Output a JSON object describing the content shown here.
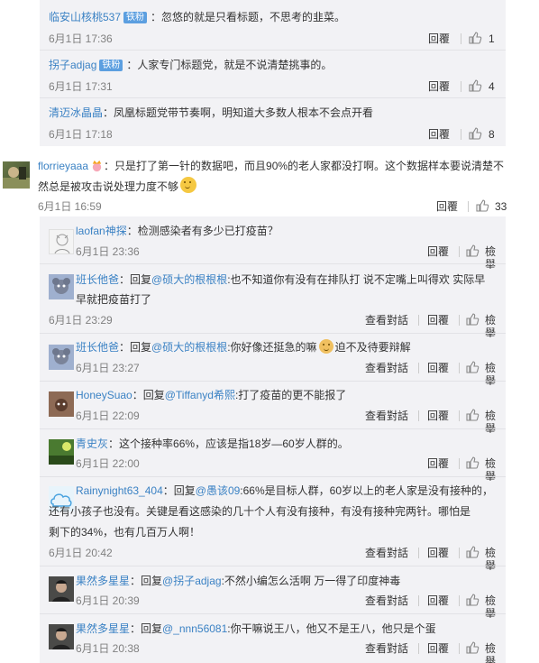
{
  "labels": {
    "reply": "回覆",
    "view_conversation": "查看對話",
    "report": "檢舉"
  },
  "top_comments": [
    {
      "user": "临安山核桃537",
      "badge": "铁粉",
      "text": "：忽悠的就是只看标题，不思考的韭菜。",
      "time": "6月1日 17:36",
      "likes": "1"
    },
    {
      "user": "拐子adjag",
      "badge": "铁粉",
      "text": "：人家专门标题党，就是不说清楚挑事的。",
      "time": "6月1日 17:31",
      "likes": "4"
    },
    {
      "user": "清迈冰晶晶",
      "text": "：凤凰标题党带节奏啊，明知道大多数人根本不会点开看",
      "time": "6月1日 17:18",
      "likes": "8"
    }
  ],
  "main_comment": {
    "user": "florrieyaaa",
    "text_part1": "：只是打了第一针的数据吧，而且90%的老人家都没打啊。这个数据样本要说清楚不",
    "text_part2": "然总是被攻击说处理力度不够",
    "time": "6月1日 16:59",
    "likes": "33"
  },
  "replies": [
    {
      "user": "laofan神探",
      "text": "：检测感染者有多少已打疫苗？",
      "time": "6月1日 23:36"
    },
    {
      "user": "班长他爸",
      "prefix": "：回复",
      "mention": "@硕大的根根根",
      "text": ":也不知道你有没有在排队打 说不定嘴上叫得欢 实际早",
      "text2": "早就把疫苗打了",
      "time": "6月1日 23:29"
    },
    {
      "user": "班长他爸",
      "prefix": "：回复",
      "mention": "@硕大的根根根",
      "text": ":你好像还挺急的嘛",
      "text_after": "迫不及待要辩解",
      "time": "6月1日 23:27"
    },
    {
      "user": "HoneySuao",
      "prefix": "：回复",
      "mention": "@Tiffanyd希熙",
      "text": ":打了疫苗的更不能报了",
      "time": "6月1日 22:09"
    },
    {
      "user": "青史灰",
      "text": "：这个接种率66%，应该是指18岁—60岁人群的。",
      "time": "6月1日 22:00"
    },
    {
      "user": "Rainynight63_404",
      "prefix": "：回复",
      "mention": "@愚该09",
      "text": ":66%是目标人群，60岁以上的老人家是没有接种的，",
      "text2": "还有小孩子也没有。关键是看这感染的几十个人有没有接种，有没有接种完两针。哪怕是",
      "text3": "剩下的34%，也有几百万人啊！",
      "time": "6月1日 20:42"
    },
    {
      "user": "果然多星星",
      "prefix": "：回复",
      "mention": "@拐子adjag",
      "text": ":不然小编怎么活啊 万一得了印度神毒",
      "time": "6月1日 20:39"
    },
    {
      "user": "果然多星星",
      "prefix": "：回复",
      "mention": "@_nnn56081",
      "text": ":你干嘛说王八，他又不是王八，他只是个蛋",
      "time": "6月1日 20:38"
    }
  ]
}
